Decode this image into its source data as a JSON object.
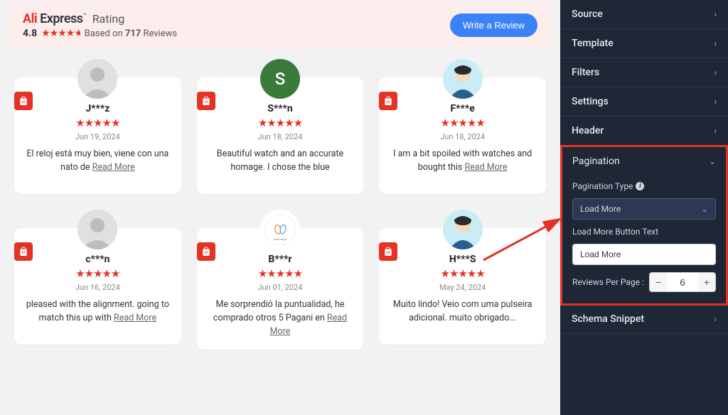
{
  "header": {
    "logo_part1": "Ali",
    "logo_part2": "Express",
    "rating_word": "Rating",
    "score": "4.8",
    "based_on_prefix": "Based on",
    "review_count": "717",
    "reviews_word": "Reviews",
    "write_review": "Write a Review"
  },
  "reviews": [
    {
      "avatar": "gray",
      "name": "J***z",
      "date": "Jun 19, 2024",
      "text": "El reloj está muy bien, viene con una nato de ",
      "read_more": "Read More"
    },
    {
      "avatar": "green",
      "initial": "S",
      "name": "S***n",
      "date": "Jun 18, 2024",
      "text": "Beautiful watch and an accurate homage. I chose the blue",
      "read_more": ""
    },
    {
      "avatar": "person",
      "name": "F***e",
      "date": "Jun 18, 2024",
      "text": "I am a bit spoiled with watches and bought this ",
      "read_more": "Read More"
    },
    {
      "avatar": "gray",
      "name": "c***n",
      "date": "Jun 16, 2024",
      "text": "pleased with the alignment. going to match this up with ",
      "read_more": "Read More"
    },
    {
      "avatar": "brain",
      "name": "B***r",
      "date": "Jun 01, 2024",
      "text": "Me sorprendió la puntualidad, he comprado otros 5 Pagani en ",
      "read_more": "Read More"
    },
    {
      "avatar": "person",
      "name": "H***S",
      "date": "May 24, 2024",
      "text": "Muito lindo! Veio com uma pulseira adicional. muito obrigado...",
      "read_more": ""
    }
  ],
  "sidebar": {
    "items": [
      "Source",
      "Template",
      "Filters",
      "Settings",
      "Header"
    ],
    "pagination": {
      "title": "Pagination",
      "type_label": "Pagination Type",
      "type_value": "Load More",
      "button_text_label": "Load More Button Text",
      "button_text_value": "Load More",
      "per_page_label": "Reviews Per Page :",
      "per_page_value": "6"
    },
    "after": [
      "Schema Snippet"
    ]
  }
}
